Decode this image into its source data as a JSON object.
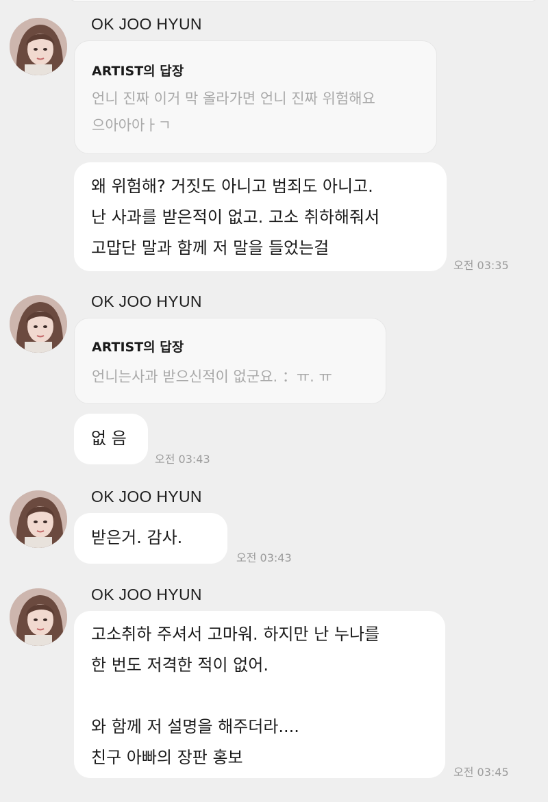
{
  "chat": {
    "groups": [
      {
        "sender": "OK JOO HYUN",
        "reply_title": "ARTIST의 답장",
        "reply_text": "언니 진짜 이거 막 올라가면 언니 진짜 위험해요\n으아아아ㅏㄱ",
        "messages": [
          {
            "text": "왜 위험해? 거짓도 아니고 범죄도 아니고.\n난 사과를 받은적이 없고. 고소 취하해줘서\n고맙단 말과 함께  저 말을 들었는걸",
            "time": "오전 03:35"
          }
        ]
      },
      {
        "sender": "OK JOO HYUN",
        "reply_title": "ARTIST의 답장",
        "reply_text": "언니는사과 받으신적이 없군요. ：ㅠ. ㅠ",
        "messages": [
          {
            "text": "없 음",
            "time": "오전 03:43"
          }
        ]
      },
      {
        "sender": "OK JOO HYUN",
        "messages": [
          {
            "text": "받은거.   감사.",
            "time": "오전 03:43"
          }
        ]
      },
      {
        "sender": "OK JOO HYUN",
        "messages": [
          {
            "text": "고소취하 주셔서 고마워. 하지만 난 누나를\n한 번도 저격한 적이 없어.\n\n와 함께 저 설명을 해주더라....\n친구 아빠의 장판 홍보",
            "time": "오전 03:45"
          }
        ]
      }
    ]
  },
  "colors": {
    "background": "#efefef",
    "bubble": "#ffffff",
    "reply_bubble": "#f8f8f8",
    "timestamp": "#9b9b9b",
    "quoted_text": "#a9a9a9"
  },
  "icons": {
    "avatar": "profile-photo-avatar"
  }
}
